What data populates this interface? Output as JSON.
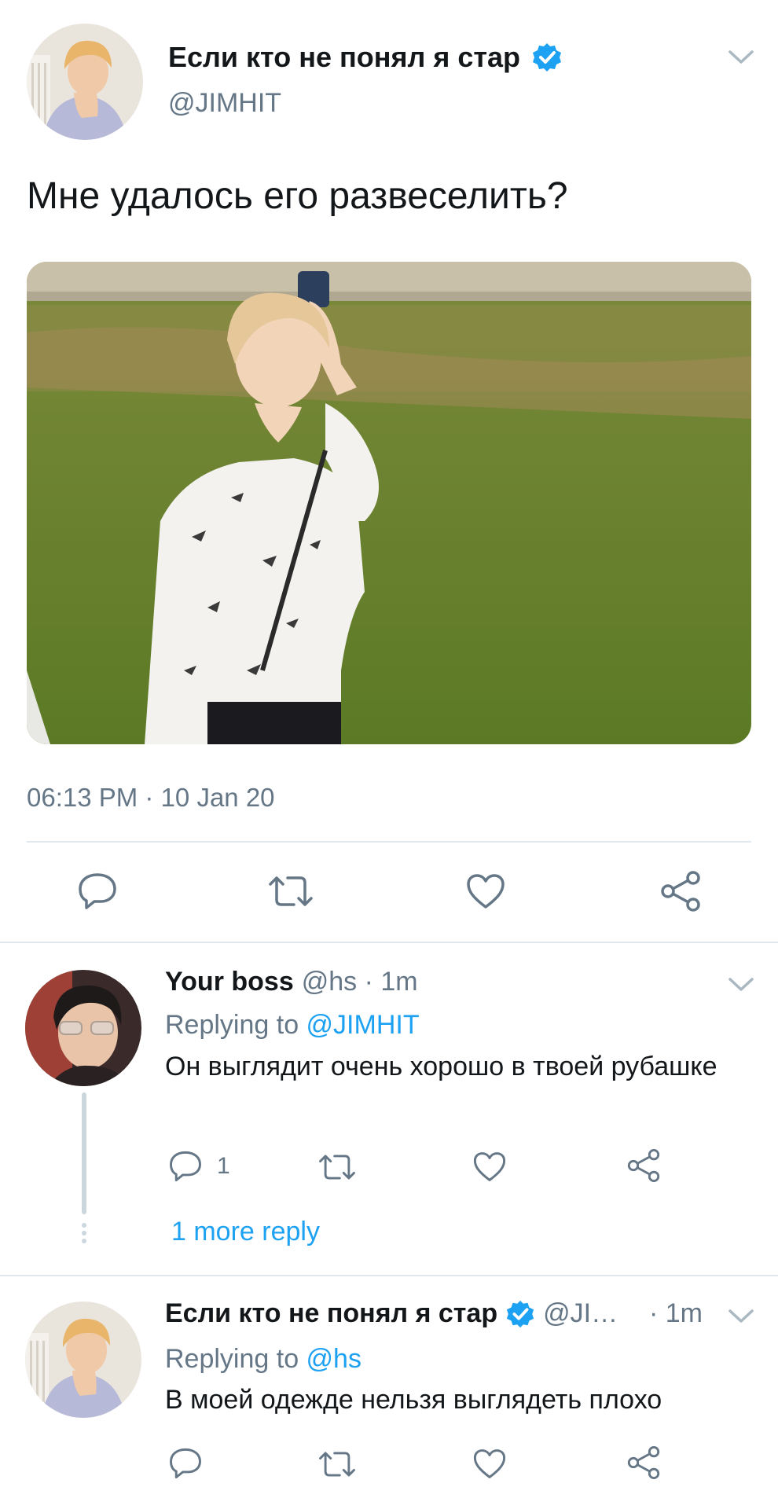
{
  "main_tweet": {
    "display_name": "Если кто не понял я стар",
    "handle": "@JIMHIT",
    "text": "Мне удалось его развеселить?",
    "timestamp": "06:13 PM · 10 Jan 20"
  },
  "replies": [
    {
      "display_name": "Your boss",
      "meta": "@hs · 1m",
      "replying_label": "Replying to ",
      "replying_to": "@JIMHIT",
      "text": "Он выглядит очень хорошо в твоей рубашке",
      "reply_count": "1",
      "more_replies": "1 more reply"
    },
    {
      "display_name": "Если кто не понял я стар",
      "meta_handle": "@JI…",
      "meta_time": "· 1m",
      "replying_label": "Replying to ",
      "replying_to": "@hs",
      "text": "В моей одежде нельзя выглядеть плохо"
    }
  ],
  "icons": {
    "reply": "reply-icon",
    "retweet": "retweet-icon",
    "like": "heart-icon",
    "share": "share-icon",
    "verified": "verified-badge-icon",
    "menu": "chevron-down-icon"
  },
  "colors": {
    "accent": "#1da1f2",
    "secondary_text": "#657786",
    "divider": "#e1e8ed"
  }
}
